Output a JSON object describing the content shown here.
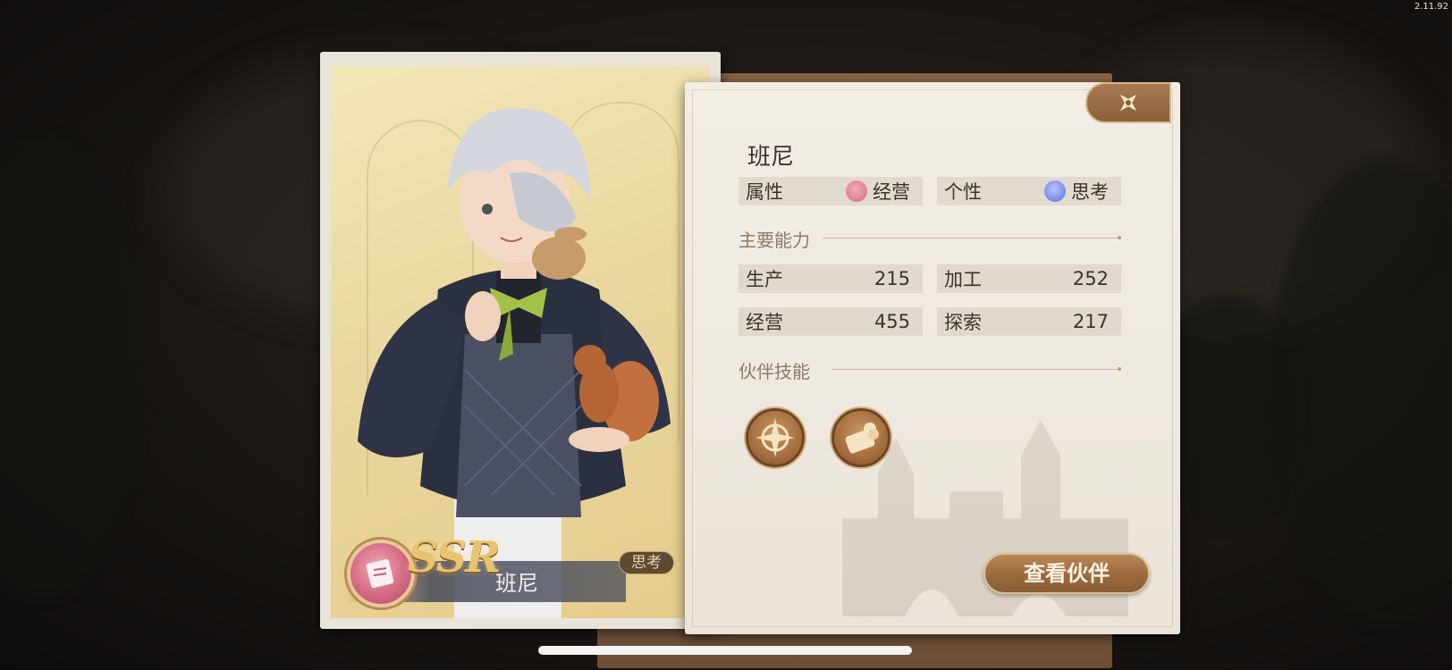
{
  "version": "2.11.92",
  "card": {
    "rarity": "SSR",
    "name": "班尼",
    "trait_tag": "思考"
  },
  "profile": {
    "name": "班尼",
    "attribute_label": "属性",
    "attribute_value": "经营",
    "personality_label": "个性",
    "personality_value": "思考"
  },
  "abilities": {
    "title": "主要能力",
    "items": [
      {
        "label": "生产",
        "value": "215"
      },
      {
        "label": "加工",
        "value": "252"
      },
      {
        "label": "经营",
        "value": "455"
      },
      {
        "label": "探索",
        "value": "217"
      }
    ]
  },
  "skills": {
    "title": "伙伴技能",
    "icons": [
      "compass-skill-icon",
      "coins-skill-icon"
    ]
  },
  "actions": {
    "view_partner": "查看伙伴"
  },
  "colors": {
    "panel_bg": "#efebe3",
    "accent_brown": "#9b6a3f",
    "attribute_pink": "#d46a84",
    "personality_blue": "#5d6fd8",
    "ssr_gold": "#e8c372"
  }
}
